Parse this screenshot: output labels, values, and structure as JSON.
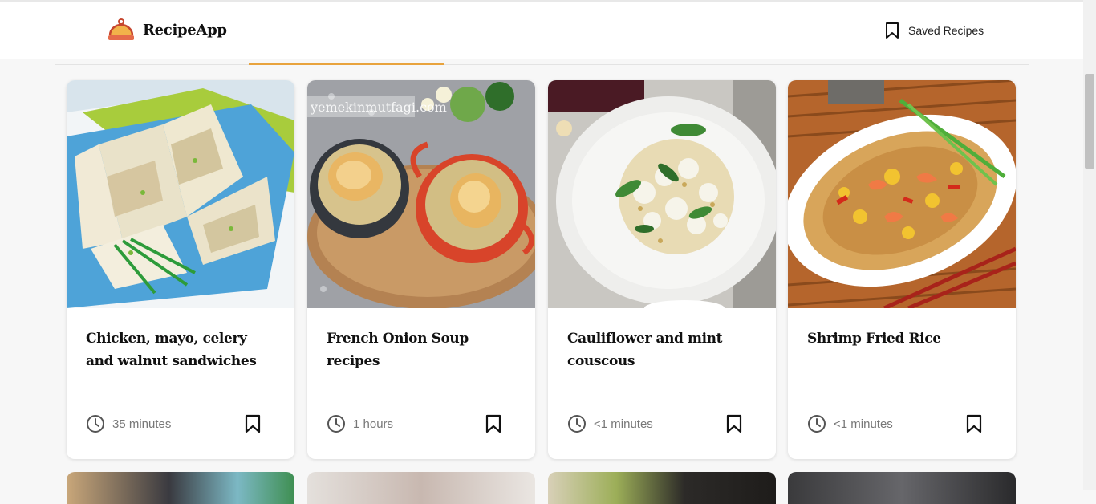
{
  "header": {
    "app_name": "RecipeApp",
    "saved_label": "Saved Recipes"
  },
  "cards": [
    {
      "title": "Chicken, mayo, celery and walnut sandwiches",
      "time": "35 minutes",
      "image": "sandwiches-photo"
    },
    {
      "title": "French Onion Soup recipes",
      "time": "1 hours",
      "image": "onion-soup-photo",
      "watermark": "yemekinmutfagi.com"
    },
    {
      "title": "Cauliflower and mint couscous",
      "time": "<1 minutes",
      "image": "couscous-photo"
    },
    {
      "title": "Shrimp Fried Rice",
      "time": "<1 minutes",
      "image": "fried-rice-photo"
    }
  ],
  "colors": {
    "accent": "#e8a33d",
    "background": "#f7f7f7"
  },
  "icons": {
    "logo": "cooking-pot-icon",
    "saved": "bookmark-icon",
    "time": "clock-icon",
    "card_save": "bookmark-icon"
  }
}
